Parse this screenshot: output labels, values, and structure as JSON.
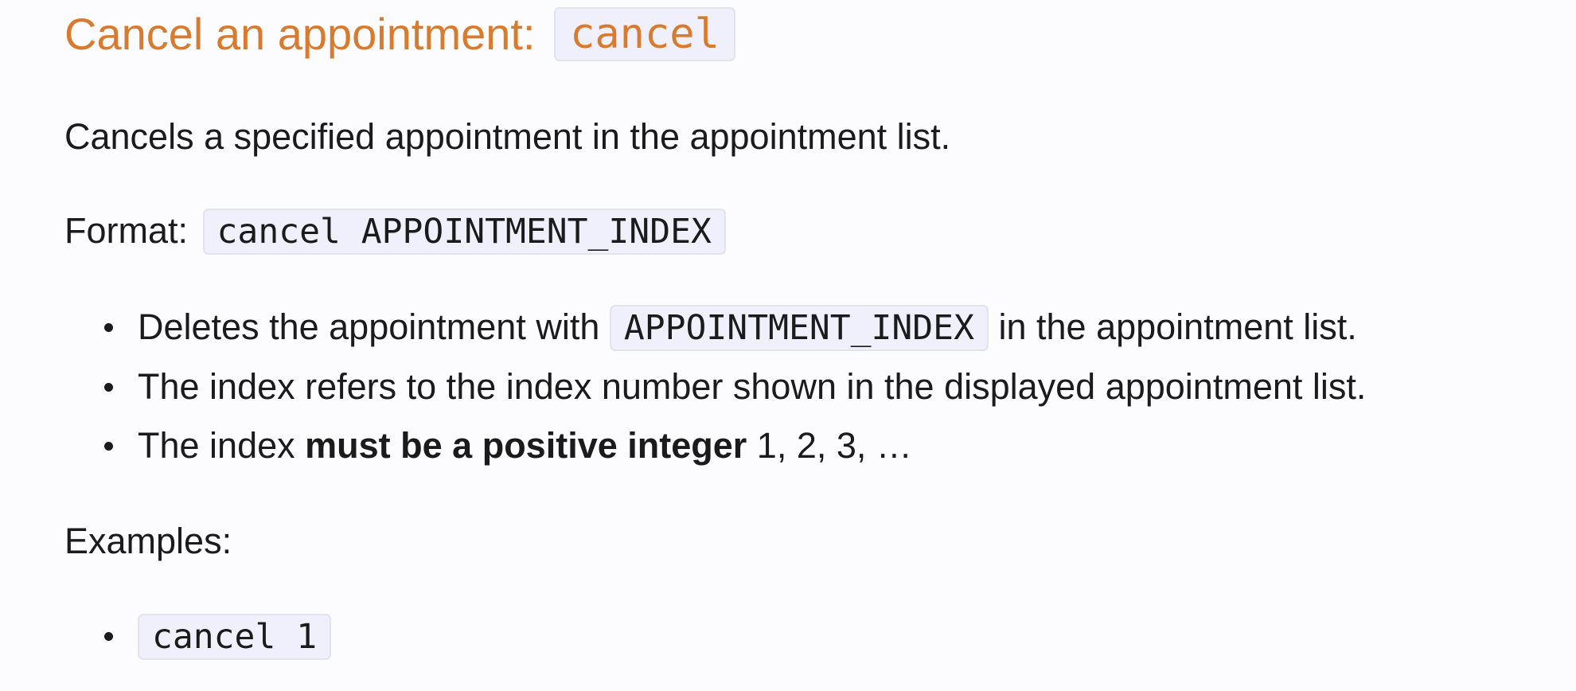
{
  "heading": {
    "text": "Cancel an appointment:",
    "code": "cancel"
  },
  "description": "Cancels a specified appointment in the appointment list.",
  "format": {
    "label": "Format:",
    "code": "cancel APPOINTMENT_INDEX"
  },
  "points": [
    {
      "before": "Deletes the appointment with",
      "code": "APPOINTMENT_INDEX",
      "after": "in the appointment list."
    },
    {
      "text": "The index refers to the index number shown in the displayed appointment list."
    },
    {
      "before": "The index",
      "bold": "must be a positive integer",
      "after": "1, 2, 3, …"
    }
  ],
  "examples": {
    "label": "Examples:",
    "items": [
      "cancel 1"
    ]
  },
  "colors": {
    "heading": "#d97b2e",
    "text": "#1b1b1b",
    "code_background": "#eff0fb",
    "code_border": "#e2e3ee",
    "page_background": "#fcfcfe"
  }
}
